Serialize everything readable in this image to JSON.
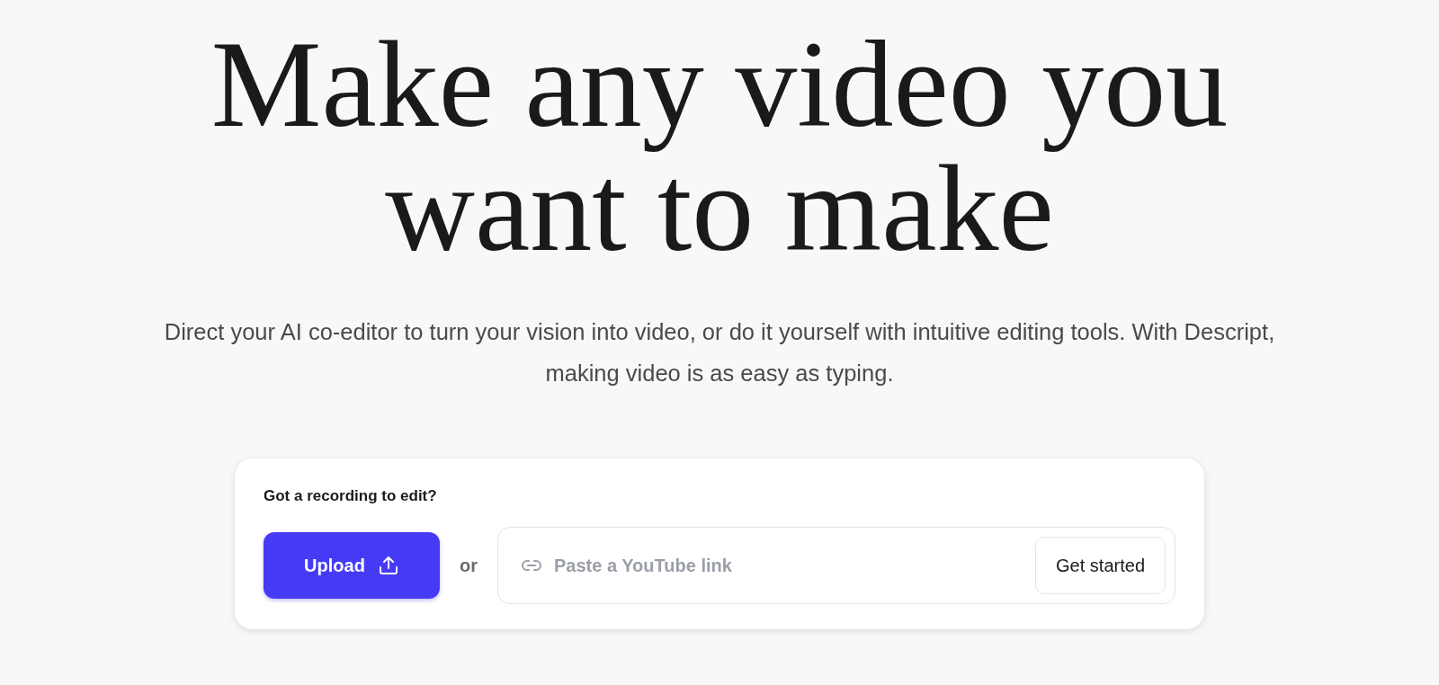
{
  "hero": {
    "heading_lines": [
      "Make any video you",
      "want to make"
    ],
    "subtitle": "Direct your AI co-editor to turn your vision into video, or do it yourself with intuitive editing tools. With Descript, making video is as easy as typing."
  },
  "upload_card": {
    "title": "Got a recording to edit?",
    "upload_button": "Upload",
    "separator": "or",
    "link_field": {
      "placeholder": "Paste a YouTube link"
    },
    "submit_button": "Get started"
  }
}
